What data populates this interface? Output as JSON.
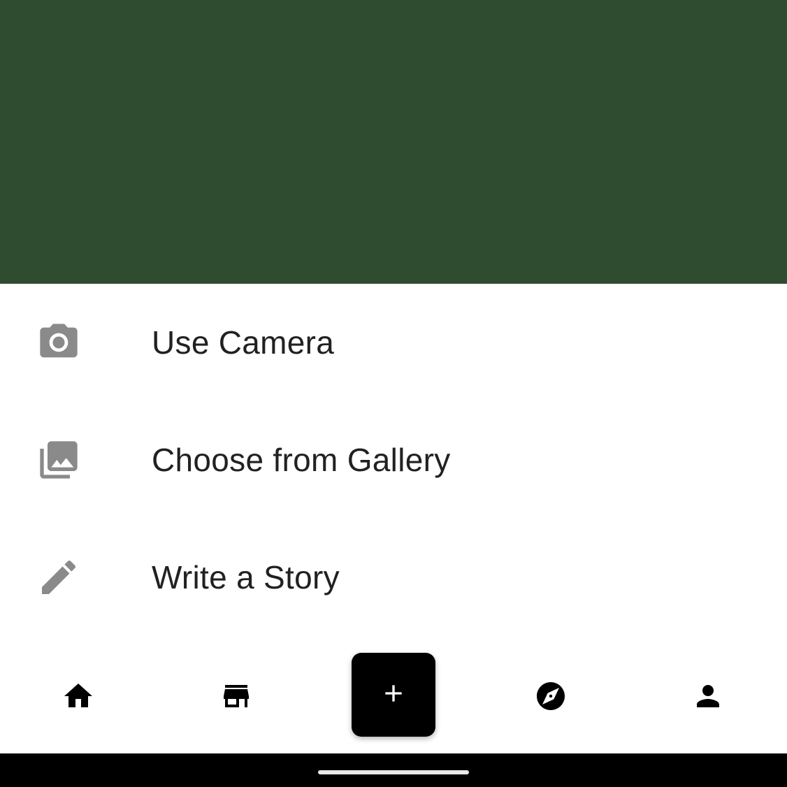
{
  "colors": {
    "scrim": "#2f4c31",
    "sheet_background": "#ffffff",
    "item_text": "#212121",
    "item_icon": "#8a8a8a",
    "nav_icon": "#000000",
    "fab_background": "#000000",
    "fab_icon": "#ffffff",
    "system_bar": "#000000"
  },
  "sheet": {
    "items": [
      {
        "label": "Use Camera",
        "icon": "camera-icon"
      },
      {
        "label": "Choose from Gallery",
        "icon": "photo-library-icon"
      },
      {
        "label": "Write a Story",
        "icon": "pencil-icon"
      }
    ]
  },
  "bottom_nav": {
    "items": [
      {
        "name": "home",
        "icon": "home-icon"
      },
      {
        "name": "store",
        "icon": "store-icon"
      },
      {
        "name": "create",
        "icon": "plus-icon"
      },
      {
        "name": "explore",
        "icon": "compass-icon"
      },
      {
        "name": "profile",
        "icon": "person-icon"
      }
    ]
  }
}
